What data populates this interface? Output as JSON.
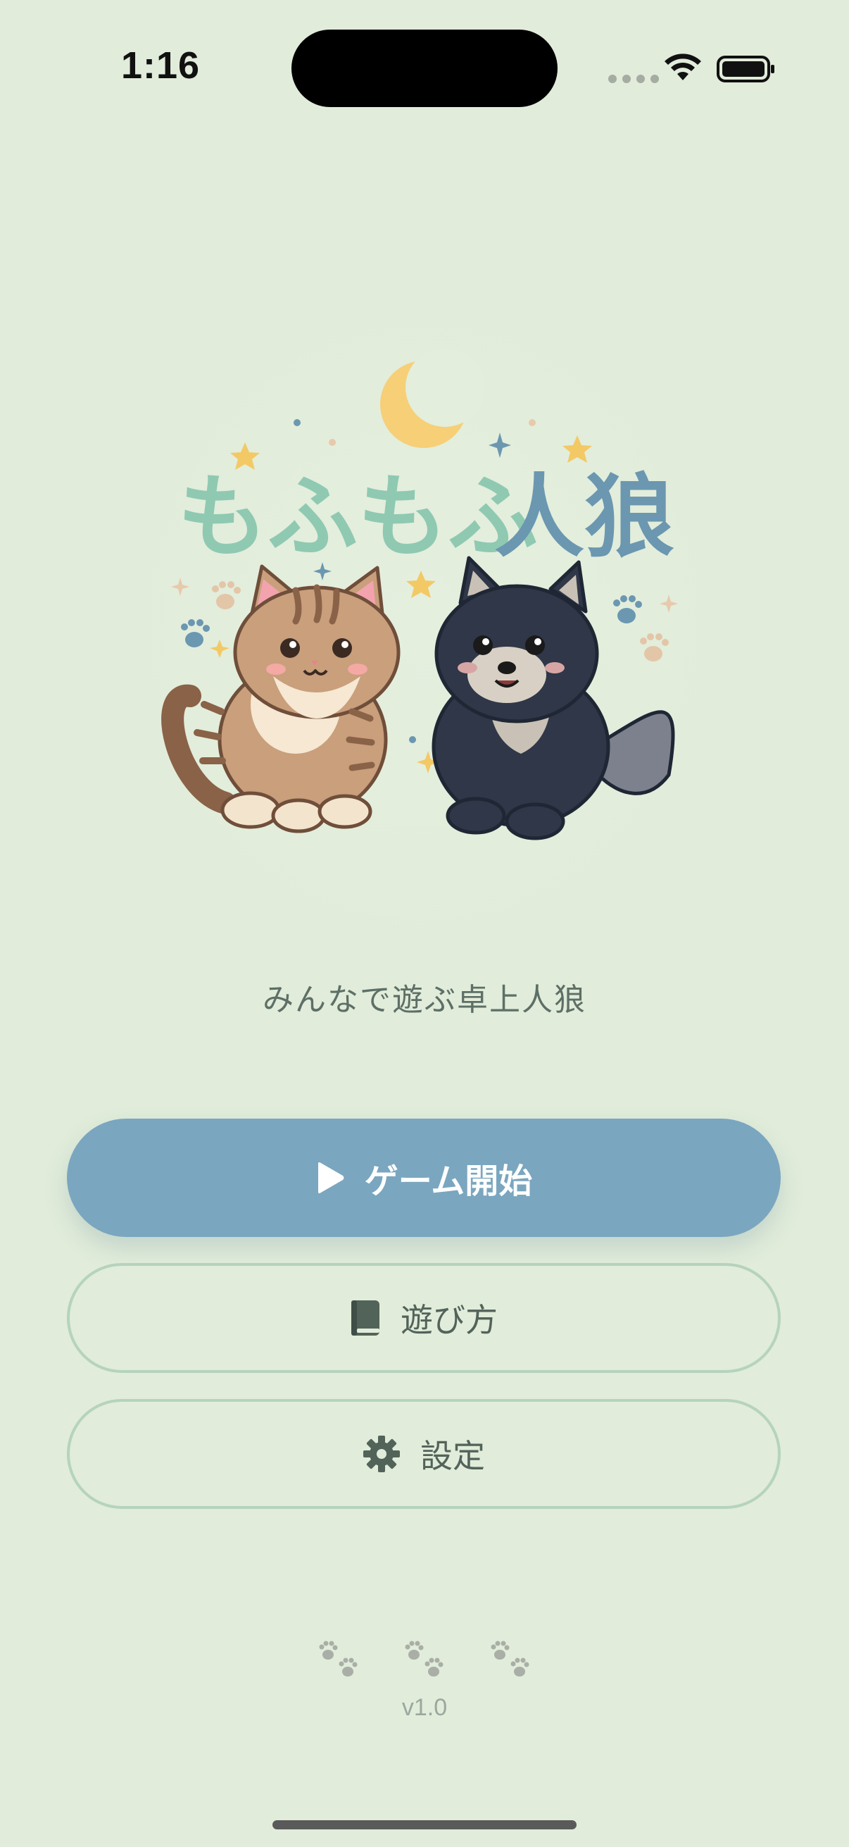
{
  "status_bar": {
    "time": "1:16"
  },
  "hero": {
    "title_part1": "もふもふ",
    "title_part2": "人狼",
    "title_color1": "#8fc9b2",
    "title_color2": "#6b97b0"
  },
  "tagline": "みんなで遊ぶ卓上人狼",
  "buttons": {
    "start": {
      "label": "ゲーム開始",
      "icon": "play-icon"
    },
    "how_to_play": {
      "label": "遊び方",
      "icon": "book-icon"
    },
    "settings": {
      "label": "設定",
      "icon": "gear-icon"
    }
  },
  "footer": {
    "version": "v1.0",
    "decor_icon": "paw-prints-icon"
  },
  "colors": {
    "background": "#e1ecda",
    "primary_button": "#7aa6bf",
    "outline_border": "#b5d3bd",
    "text_muted": "#5d6f66"
  }
}
